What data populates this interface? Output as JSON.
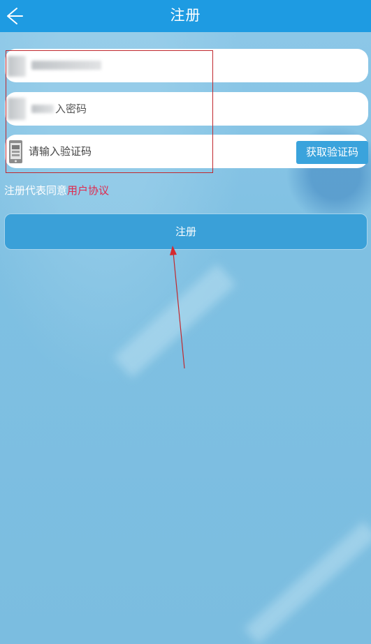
{
  "header": {
    "title": "注册",
    "back_icon": "arrow-left-icon"
  },
  "form": {
    "phone_placeholder": "请输入手机号",
    "password_placeholder": "请输入密码",
    "password_visible_text": "入密码",
    "code_placeholder": "请输入验证码",
    "code_icon": "phone-icon",
    "get_code_label": "获取验证码"
  },
  "agreement": {
    "prefix": "注册代表同意",
    "link": "用户协议"
  },
  "register_label": "注册",
  "colors": {
    "header": "#1e9be2",
    "background": "#7dbde0",
    "button": "#3aa0d8",
    "link": "#e0294e",
    "annotation": "#c0282e"
  }
}
